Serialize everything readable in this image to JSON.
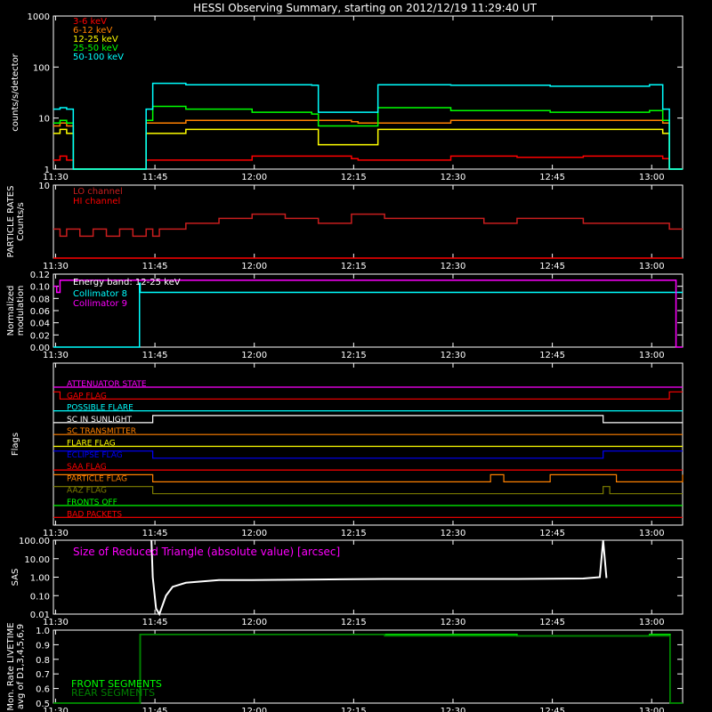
{
  "title": "HESSI Observing Summary, starting on 2012/12/19 11:29:40 UT",
  "time_ticks": [
    "11:30",
    "11:45",
    "12:00",
    "12:15",
    "12:30",
    "12:45",
    "13:00"
  ],
  "colors": {
    "red": "#ff0000",
    "orange": "#ff8000",
    "yellow": "#ffff00",
    "green": "#00ff00",
    "cyan": "#00ffff",
    "magenta": "#ff00ff",
    "darkred": "#c81e1e",
    "white": "#ffffff"
  },
  "chart_data": [
    {
      "type": "line",
      "ylabel": "counts/s/detector",
      "yscale": "log",
      "ylim": [
        1,
        1000
      ],
      "y_ticks": [
        "1",
        "10",
        "100",
        "1000"
      ],
      "x_range_minutes": [
        0,
        95
      ],
      "series": [
        {
          "name": "3-6 keV",
          "color": "#ff0000",
          "x": [
            0,
            1,
            2,
            3,
            13,
            14,
            30,
            45,
            46,
            60,
            70,
            80,
            92,
            93,
            95
          ],
          "y": [
            1.5,
            1.8,
            1.5,
            1,
            1,
            1.5,
            1.8,
            1.6,
            1.5,
            1.8,
            1.7,
            1.8,
            1.6,
            1,
            1
          ]
        },
        {
          "name": "6-12 keV",
          "color": "#ff8000",
          "x": [
            0,
            1,
            2,
            3,
            13,
            14,
            20,
            30,
            45,
            46,
            60,
            75,
            90,
            92,
            93,
            95
          ],
          "y": [
            7,
            8,
            7,
            1,
            1,
            8,
            9,
            9,
            8.5,
            8,
            9,
            9,
            9,
            8,
            1,
            1
          ]
        },
        {
          "name": "12-25 keV",
          "color": "#ffff00",
          "x": [
            0,
            1,
            2,
            3,
            13,
            14,
            20,
            30,
            39,
            40,
            48,
            49,
            60,
            75,
            90,
            92,
            93,
            95
          ],
          "y": [
            5,
            6,
            5,
            1,
            1,
            5,
            6,
            6,
            6,
            3,
            3,
            6,
            6,
            6,
            6,
            5,
            1,
            1
          ]
        },
        {
          "name": "25-50 keV",
          "color": "#00ff00",
          "x": [
            0,
            1,
            2,
            3,
            13,
            14,
            15,
            20,
            30,
            39,
            40,
            48,
            49,
            60,
            75,
            90,
            92,
            93,
            95
          ],
          "y": [
            8,
            9,
            8,
            1,
            1,
            9,
            17,
            15,
            13,
            12,
            7,
            7,
            16,
            14,
            13,
            14,
            9,
            1,
            1
          ]
        },
        {
          "name": "50-100 keV",
          "color": "#00ffff",
          "x": [
            0,
            1,
            2,
            3,
            13,
            14,
            15,
            20,
            30,
            39,
            40,
            48,
            49,
            60,
            75,
            90,
            92,
            93,
            95
          ],
          "y": [
            15,
            16,
            15,
            1,
            1,
            15,
            48,
            45,
            45,
            44,
            13,
            13,
            45,
            44,
            42,
            45,
            15,
            1,
            1
          ]
        }
      ]
    },
    {
      "type": "line",
      "ylabel_lines": [
        "PARTICLE RATES",
        "Counts/s"
      ],
      "yscale": "log",
      "ylim": [
        1,
        10
      ],
      "y_ticks": [
        "10"
      ],
      "series": [
        {
          "name": "LO channel",
          "color": "#c81e1e",
          "x": [
            0,
            1,
            2,
            4,
            6,
            8,
            10,
            12,
            14,
            15,
            16,
            20,
            25,
            30,
            35,
            40,
            45,
            50,
            55,
            60,
            65,
            70,
            75,
            80,
            85,
            90,
            93,
            95
          ],
          "y": [
            2.5,
            2,
            2.5,
            2,
            2.5,
            2,
            2.5,
            2,
            2.5,
            2,
            2.5,
            3,
            3.5,
            4,
            3.5,
            3,
            4,
            3.5,
            3.5,
            3.5,
            3,
            3.5,
            3.5,
            3,
            3,
            3,
            2.5,
            2.5
          ]
        },
        {
          "name": "HI channel",
          "color": "#ff0000",
          "x": [
            0,
            95
          ],
          "y": [
            1,
            1
          ]
        }
      ]
    },
    {
      "type": "line",
      "ylabel_lines": [
        "Normalized",
        "modulation"
      ],
      "ylim": [
        0,
        0.12
      ],
      "y_ticks": [
        "0.00",
        "0.02",
        "0.04",
        "0.06",
        "0.08",
        "0.10",
        "0.12"
      ],
      "energy_band": "Energy band: 12-25 keV",
      "series": [
        {
          "name": "Collimator 8",
          "color": "#00ffff",
          "x": [
            0,
            12.9,
            13,
            13.1,
            95
          ],
          "y": [
            0,
            0,
            0.105,
            0.09,
            0.09
          ]
        },
        {
          "name": "Collimator 9",
          "color": "#ff00ff",
          "x": [
            0,
            0.5,
            1,
            13,
            14,
            93,
            94,
            95
          ],
          "y": [
            0.1,
            0.09,
            0.11,
            0.11,
            0.11,
            0.11,
            0,
            0
          ]
        }
      ]
    },
    {
      "type": "line",
      "ylabel": "Flags",
      "flags": [
        {
          "name": "ATTENUATOR STATE",
          "color": "#ff00ff",
          "x": [
            0,
            95
          ],
          "v": [
            0,
            0
          ]
        },
        {
          "name": "GAP FLAG",
          "color": "#ff0000",
          "x": [
            0,
            1,
            93,
            95
          ],
          "v": [
            1,
            0,
            1,
            1
          ]
        },
        {
          "name": "POSSIBLE FLARE",
          "color": "#00ffff",
          "x": [
            0,
            95
          ],
          "v": [
            0,
            0
          ]
        },
        {
          "name": "SC IN SUNLIGHT",
          "color": "#ffffff",
          "x": [
            0,
            15,
            83,
            95
          ],
          "v": [
            0,
            1,
            0,
            0
          ]
        },
        {
          "name": "SC TRANSMITTER",
          "color": "#ff8000",
          "x": [
            0,
            95
          ],
          "v": [
            0,
            0
          ]
        },
        {
          "name": "FLARE FLAG",
          "color": "#ffff00",
          "x": [
            0,
            95
          ],
          "v": [
            0,
            0
          ]
        },
        {
          "name": "ECLIPSE FLAG",
          "color": "#0000ff",
          "x": [
            0,
            15,
            83,
            95
          ],
          "v": [
            1,
            0,
            1,
            1
          ]
        },
        {
          "name": "SAA FLAG",
          "color": "#ff0000",
          "x": [
            0,
            95
          ],
          "v": [
            0,
            0
          ]
        },
        {
          "name": "PARTICLE FLAG",
          "color": "#ff8000",
          "x": [
            0,
            15,
            66,
            68,
            75,
            85,
            95
          ],
          "v": [
            1,
            0,
            1,
            0,
            1,
            0,
            1
          ]
        },
        {
          "name": "AAZ FLAG",
          "color": "#808000",
          "x": [
            0,
            15,
            83,
            84,
            95
          ],
          "v": [
            1,
            0,
            1,
            0,
            0
          ]
        },
        {
          "name": "FRONTS OFF",
          "color": "#00ff00",
          "x": [
            0,
            95
          ],
          "v": [
            0,
            0
          ]
        },
        {
          "name": "BAD PACKETS",
          "color": "#ff0000",
          "x": [
            0,
            95
          ],
          "v": [
            0,
            0
          ]
        }
      ]
    },
    {
      "type": "line",
      "ylabel": "SAS",
      "yscale": "log",
      "ylim": [
        0.01,
        100
      ],
      "y_ticks": [
        "0.01",
        "0.10",
        "1.00",
        "10.00",
        "100.00"
      ],
      "inner_label": "Size of Reduced Triangle (absolute value) [arcsec]",
      "series": [
        {
          "name": "SAS",
          "color": "#ffffff",
          "x": [
            14.8,
            15,
            15.5,
            16,
            17,
            18,
            20,
            25,
            30,
            40,
            50,
            60,
            70,
            80,
            82.5,
            83,
            83.5
          ],
          "y": [
            100,
            1,
            0.02,
            0.01,
            0.1,
            0.3,
            0.5,
            0.7,
            0.7,
            0.75,
            0.8,
            0.8,
            0.8,
            0.85,
            1,
            100,
            0.9
          ]
        }
      ]
    },
    {
      "type": "line",
      "ylabel_lines": [
        "Mon. Rate LIVETIME",
        "avg of D1,3,4,5,6,9"
      ],
      "ylim": [
        0.5,
        1.0
      ],
      "y_ticks": [
        "0.5",
        "0.6",
        "0.7",
        "0.8",
        "0.9",
        "1.0"
      ],
      "series": [
        {
          "name": "FRONT SEGMENTS",
          "color": "#00ff00",
          "x": [
            0,
            13,
            13.1,
            30,
            50,
            70,
            90,
            93,
            93.1,
            95
          ],
          "y": [
            0.5,
            0.5,
            0.97,
            0.97,
            0.97,
            0.96,
            0.97,
            0.97,
            0.5,
            0.5
          ]
        },
        {
          "name": "REAR SEGMENTS",
          "color": "#008000",
          "x": [
            0,
            13,
            13.1,
            30,
            50,
            70,
            90,
            93,
            93.1,
            95
          ],
          "y": [
            0.5,
            0.5,
            0.97,
            0.97,
            0.96,
            0.96,
            0.96,
            0.96,
            0.5,
            0.5
          ]
        }
      ]
    }
  ]
}
